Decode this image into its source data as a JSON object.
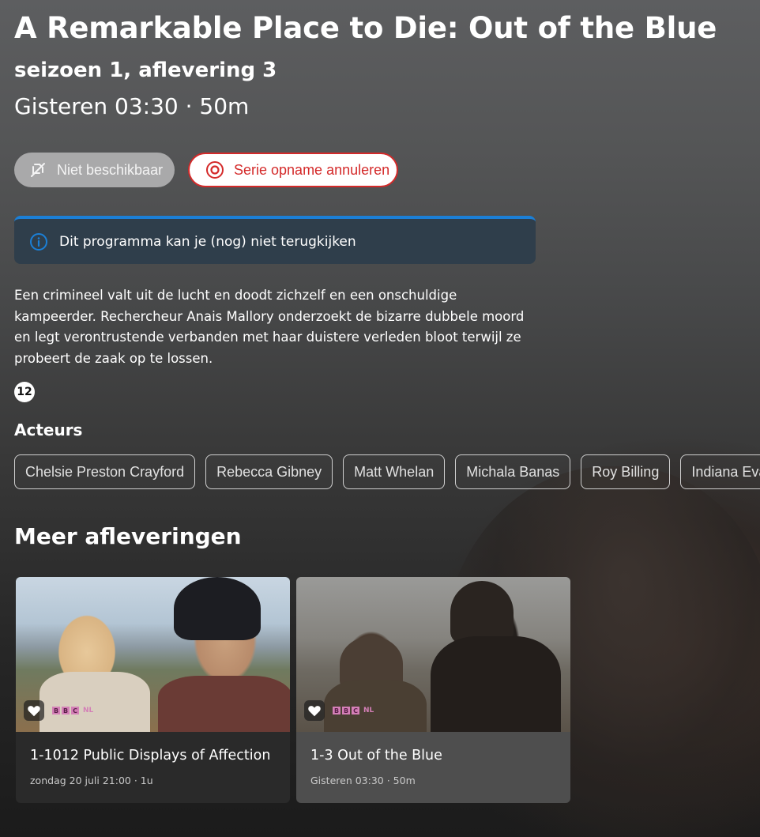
{
  "program": {
    "title": "A Remarkable Place to Die: Out of the Blue",
    "subtitle": "seizoen 1, aflevering 3",
    "meta": "Gisteren 03:30 · 50m"
  },
  "actions": {
    "unavailable_label": "Niet beschikbaar",
    "cancel_recording_label": "Serie opname annuleren"
  },
  "info_banner": {
    "text": "Dit programma kan je (nog) niet terugkijken"
  },
  "description": "Een crimineel valt uit de lucht en doodt zichzelf en een onschuldige kampeerder. Rechercheur Anais Mallory onderzoekt de bizarre dubbele moord en legt verontrustende verbanden met haar duistere verleden bloot terwijl ze probeert de zaak op te lossen.",
  "age_rating": "12",
  "actors": {
    "heading": "Acteurs",
    "items": [
      "Chelsie Preston Crayford",
      "Rebecca Gibney",
      "Matt Whelan",
      "Michala Banas",
      "Roy Billing",
      "Indiana Evans"
    ]
  },
  "more_episodes": {
    "heading": "Meer afleveringen",
    "items": [
      {
        "title": "1-1012 Public Displays of Affection",
        "meta": "zondag 20 juli 21:00 · 1u",
        "channel_logo": "BBC NL"
      },
      {
        "title": "1-3 Out of the Blue",
        "meta": "Gisteren 03:30 · 50m",
        "channel_logo": "BBC NL"
      }
    ]
  },
  "colors": {
    "accent_red": "#d42a2a",
    "info_blue": "#1b7fd6",
    "info_bg": "#2f3e4b",
    "bbc_pink": "#d47fb7"
  },
  "icons": {
    "unavailable": "crossed-out-icon",
    "record": "record-icon",
    "info": "info-icon",
    "favorite": "heart-icon"
  }
}
